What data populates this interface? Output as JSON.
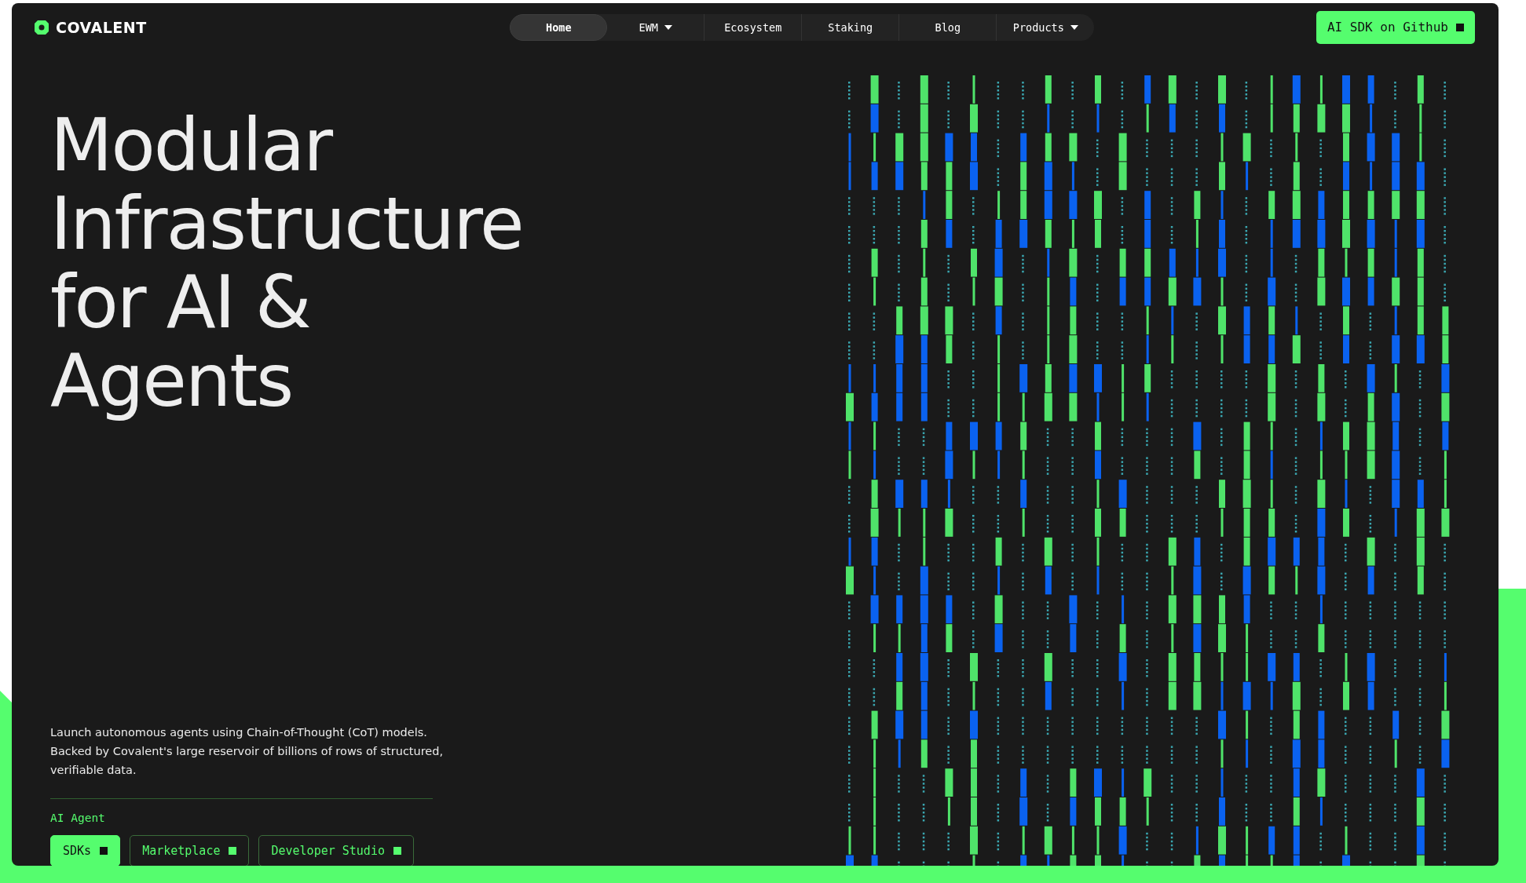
{
  "logo": {
    "text": "COVALENT"
  },
  "nav": [
    {
      "label": "Home",
      "selected": true,
      "dropdown": false
    },
    {
      "label": "EWM",
      "selected": false,
      "dropdown": true
    },
    {
      "label": "Ecosystem",
      "selected": false,
      "dropdown": false
    },
    {
      "label": "Staking",
      "selected": false,
      "dropdown": false
    },
    {
      "label": "Blog",
      "selected": false,
      "dropdown": false
    },
    {
      "label": "Products",
      "selected": false,
      "dropdown": true
    }
  ],
  "cta": {
    "label": "AI SDK on Github"
  },
  "hero": {
    "headline": "Modular Infrastructure for AI & Agents",
    "description": "Launch autonomous agents using Chain-of-Thought (CoT) models. Backed by Covalent's large reservoir of billions of rows of structured, verifiable data.",
    "section_label": "AI Agent",
    "buttons": [
      {
        "label": "SDKs",
        "selected": true
      },
      {
        "label": "Marketplace",
        "selected": false
      },
      {
        "label": "Developer Studio",
        "selected": false
      }
    ]
  }
}
